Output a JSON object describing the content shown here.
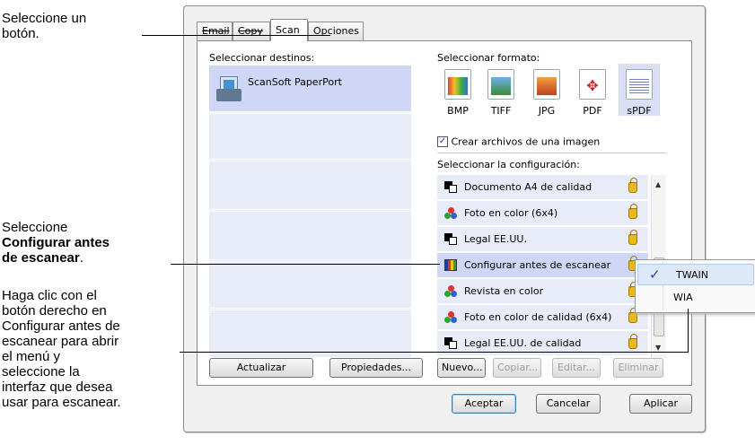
{
  "annotations": {
    "select_button": [
      "Seleccione un",
      "botón."
    ],
    "configure": {
      "line1": "Seleccione",
      "line2": "Configurar antes",
      "line3": "de escanear",
      "suffix": "."
    },
    "right_click": [
      "Haga clic con el",
      "botón derecho en",
      "Configurar antes de",
      "escanear para abrir",
      "el menú y",
      "seleccione la",
      "interfaz que desea",
      "usar para escanear."
    ]
  },
  "tabs": [
    {
      "label": "Email",
      "active": false,
      "struck": true
    },
    {
      "label": "Copy",
      "active": false,
      "struck": true
    },
    {
      "label": "Scan",
      "active": true,
      "struck": false
    },
    {
      "label": "Opciones",
      "active": false,
      "struck": false
    }
  ],
  "destinations": {
    "label": "Seleccionar destinos:",
    "items": [
      {
        "name": "ScanSoft PaperPort",
        "icon": "paperport-icon",
        "selected": true
      }
    ]
  },
  "formats": {
    "label": "Seleccionar formato:",
    "items": [
      {
        "label": "BMP",
        "icon": "bmp-icon",
        "selected": false
      },
      {
        "label": "TIFF",
        "icon": "tiff-icon",
        "selected": false
      },
      {
        "label": "JPG",
        "icon": "jpg-icon",
        "selected": false
      },
      {
        "label": "PDF",
        "icon": "pdf-icon",
        "selected": false
      },
      {
        "label": "sPDF",
        "icon": "spdf-icon",
        "selected": true
      }
    ],
    "checkbox_label": "Crear archivos de una imagen",
    "checkbox_checked": true
  },
  "configs": {
    "label": "Seleccionar la configuración:",
    "items": [
      {
        "name": "Documento A4 de calidad",
        "icon": "bw-document-icon",
        "selected": false
      },
      {
        "name": "Foto en color (6x4)",
        "icon": "color-photo-icon",
        "selected": false
      },
      {
        "name": "Legal EE.UU.",
        "icon": "bw-document-icon",
        "selected": false
      },
      {
        "name": "Configurar antes de escanear",
        "icon": "configure-icon",
        "selected": true
      },
      {
        "name": "Revista en color",
        "icon": "color-photo-icon",
        "selected": false
      },
      {
        "name": "Foto en color de calidad (6x4)",
        "icon": "color-photo-icon",
        "selected": false
      },
      {
        "name": "Legal EE.UU. de calidad",
        "icon": "bw-document-icon",
        "selected": false
      }
    ]
  },
  "buttons": {
    "refresh": "Actualizar",
    "properties": "Propiedades...",
    "new": "Nuevo...",
    "copy": "Copiar...",
    "edit": "Editar...",
    "delete": "Eliminar",
    "accept": "Aceptar",
    "cancel": "Cancelar",
    "apply": "Aplicar"
  },
  "context_menu": {
    "items": [
      {
        "label": "TWAIN",
        "checked": true
      },
      {
        "label": "WIA",
        "checked": false
      }
    ]
  },
  "colors": {
    "selection": "#d0d6f6",
    "list_bg": "#e8ecf8",
    "dialog_bg": "#f0f0f0"
  }
}
